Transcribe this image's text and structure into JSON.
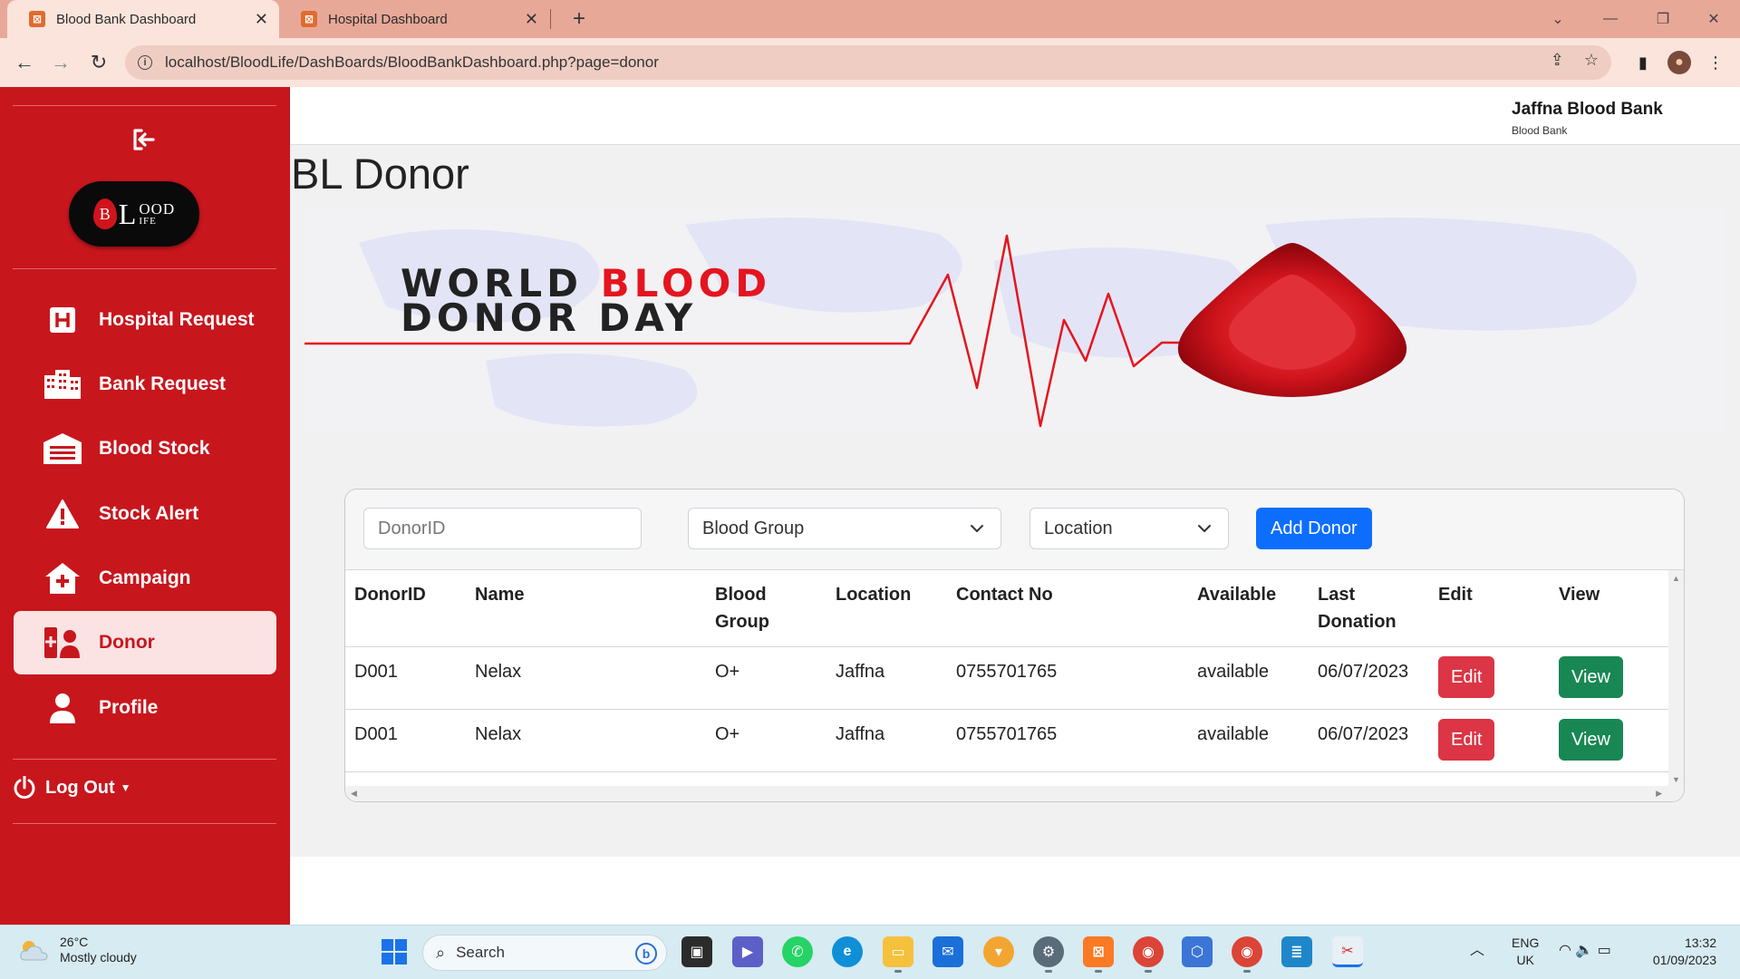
{
  "browser": {
    "tabs": [
      {
        "title": "Blood Bank Dashboard",
        "active": true
      },
      {
        "title": "Hospital Dashboard",
        "active": false
      }
    ],
    "url": "localhost/BloodLife/DashBoards/BloodBankDashboard.php?page=donor"
  },
  "sidebar": {
    "logo_text": "OOD",
    "logo_sub": "IFE",
    "items": [
      {
        "label": "Hospital Request",
        "icon": "hospital-icon"
      },
      {
        "label": "Bank Request",
        "icon": "building-icon"
      },
      {
        "label": "Blood Stock",
        "icon": "warehouse-icon"
      },
      {
        "label": "Stock Alert",
        "icon": "warning-icon"
      },
      {
        "label": "Campaign",
        "icon": "house-medical-icon"
      },
      {
        "label": "Donor",
        "icon": "user-injured-icon",
        "active": true
      },
      {
        "label": "Profile",
        "icon": "user-icon"
      }
    ],
    "logout_label": "Log Out"
  },
  "header": {
    "user_name": "Jaffna Blood Bank",
    "user_role": "Blood Bank"
  },
  "page": {
    "title": "BL Donor",
    "banner": {
      "line1a": "WORLD",
      "line1b": "BLOOD",
      "line2": "DONOR DAY"
    }
  },
  "filters": {
    "donorid_placeholder": "DonorID",
    "blood_group": "Blood Group",
    "location": "Location",
    "add_button": "Add Donor"
  },
  "table": {
    "headers": {
      "donorid": "DonorID",
      "name": "Name",
      "blood_group_1": "Blood",
      "blood_group_2": "Group",
      "location": "Location",
      "contact": "Contact No",
      "available": "Available",
      "last_donation_1": "Last",
      "last_donation_2": "Donation",
      "edit": "Edit",
      "view": "View"
    },
    "rows": [
      {
        "donorid": "D001",
        "name": "Nelax",
        "blood_group": "O+",
        "location": "Jaffna",
        "contact": "0755701765",
        "available": "available",
        "last_donation": "06/07/2023",
        "edit": "Edit",
        "view": "View"
      },
      {
        "donorid": "D001",
        "name": "Nelax",
        "blood_group": "O+",
        "location": "Jaffna",
        "contact": "0755701765",
        "available": "available",
        "last_donation": "06/07/2023",
        "edit": "Edit",
        "view": "View"
      }
    ]
  },
  "taskbar": {
    "weather_temp": "26°C",
    "weather_desc": "Mostly cloudy",
    "search_label": "Search",
    "lang_1": "ENG",
    "lang_2": "UK",
    "time": "13:32",
    "date": "01/09/2023"
  },
  "colors": {
    "brand_red": "#c8161d",
    "primary_blue": "#0d6efd",
    "danger": "#dc3545",
    "success": "#198754"
  }
}
